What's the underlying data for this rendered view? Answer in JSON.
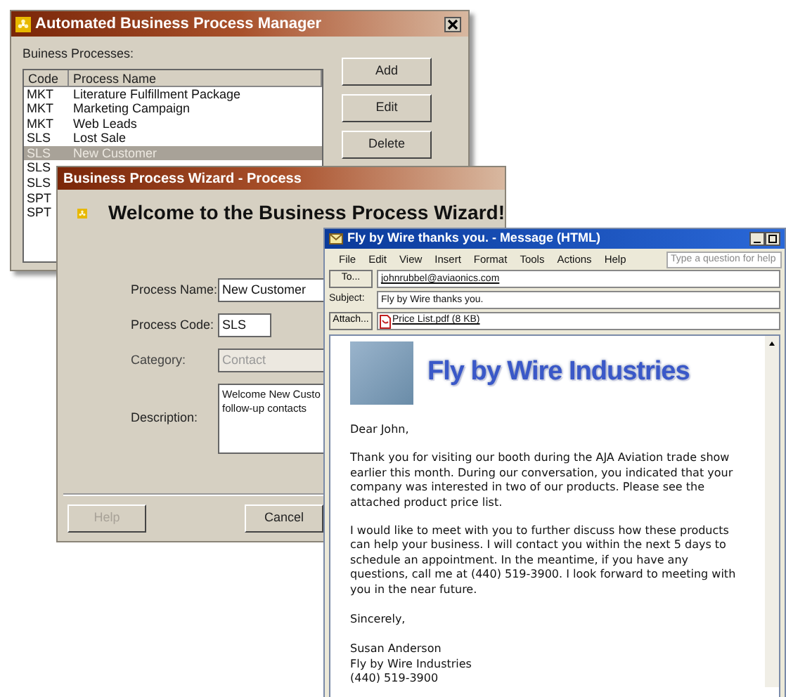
{
  "manager": {
    "title": "Automated Business Process Manager",
    "list_label": "Buiness Processes:",
    "columns": [
      "Code",
      "Process Name"
    ],
    "rows": [
      {
        "code": "MKT",
        "name": "Literature Fulfillment Package",
        "selected": false
      },
      {
        "code": "MKT",
        "name": "Marketing Campaign",
        "selected": false
      },
      {
        "code": "MKT",
        "name": "Web Leads",
        "selected": false
      },
      {
        "code": "SLS",
        "name": "Lost Sale",
        "selected": false
      },
      {
        "code": "SLS",
        "name": "New Customer",
        "selected": true
      },
      {
        "code": "SLS",
        "selected": false
      },
      {
        "code": "SLS",
        "selected": false
      },
      {
        "code": "SPT",
        "selected": false
      },
      {
        "code": "SPT",
        "selected": false
      }
    ],
    "buttons": [
      "Add",
      "Edit",
      "Delete"
    ]
  },
  "wizard": {
    "title": "Business Process Wizard - Process",
    "heading": "Welcome to the Business Process Wizard!",
    "fields": [
      {
        "kind": "text",
        "label": "Process Name:",
        "value": "New Customer",
        "disabled": false
      },
      {
        "kind": "short",
        "label": "Process Code:",
        "value": "SLS",
        "disabled": false
      },
      {
        "kind": "text",
        "label": "Category:",
        "value": "Contact",
        "disabled": true
      },
      {
        "kind": "multiline",
        "label": "Description:",
        "lines": [
          "Welcome New Custo",
          "follow-up contacts"
        ],
        "disabled": false
      }
    ],
    "buttons": [
      {
        "label": "Help",
        "disabled": true
      },
      {
        "label": "Cancel",
        "disabled": false
      }
    ]
  },
  "message": {
    "title": "Fly by Wire thanks you. - Message (HTML)",
    "menu": [
      "File",
      "Edit",
      "View",
      "Insert",
      "Format",
      "Tools",
      "Actions",
      "Help"
    ],
    "help_placeholder": "Type a question for help",
    "to_button": "To...",
    "to": "johnrubbel@aviaonics.com",
    "subject_label": "Subject:",
    "subject": "Fly by Wire thanks you.",
    "attach_button": "Attach...",
    "attachment": "Price List.pdf (8 KB)",
    "logo_text": "Fly by Wire Industries",
    "greeting": "Dear John,",
    "paragraphs": [
      "Thank you for visiting our booth during the AJA Aviation trade show earlier this month.  During our conversation, you indicated that your company was interested in two of our products.  Please see the attached product price list.",
      "I would like to meet with you to further discuss how these products can help your business. I will contact you within the next 5 days to schedule an appointment. In the meantime, if you have any questions, call me at (440) 519-3900. I look forward to meeting with you in the near future."
    ],
    "closing": "Sincerely,",
    "signature": [
      "Susan Anderson",
      "Fly by Wire Industries",
      "(440) 519-3900"
    ]
  }
}
